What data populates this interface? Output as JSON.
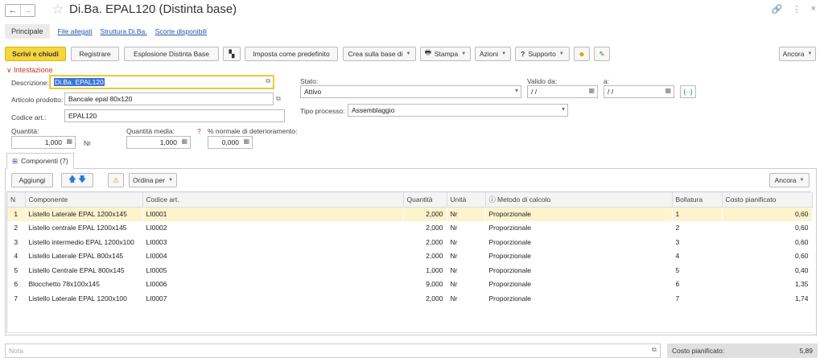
{
  "header": {
    "title": "Di.Ba. EPAL120 (Distinta base)",
    "back": "←",
    "forward": "→",
    "star": "☆",
    "link": "🔗",
    "more": "⋮",
    "close": "×"
  },
  "tabs": [
    {
      "label": "Principale"
    },
    {
      "label": "File allegati"
    },
    {
      "label": "Struttura Di.Ba."
    },
    {
      "label": "Scorte disponibili"
    }
  ],
  "toolbar": {
    "write_close": "Scrivi e chiudi",
    "register": "Registrare",
    "explode": "Esplosione Distinta Base",
    "set_default": "Imposta come predefinito",
    "create_based": "Crea sulla base di",
    "print": "Stampa",
    "actions": "Azioni",
    "support": "Supporto",
    "more": "Ancora"
  },
  "section": {
    "label": "Intestazione"
  },
  "form": {
    "descrizione_label": "Descrizione:",
    "descrizione_value": "Di.Ba. EPAL120",
    "articolo_label": "Articolo prodotto:",
    "articolo_value": "Bancale epal 80x120",
    "codice_label": "Codice art.:",
    "codice_value": "EPAL120",
    "quantita_label": "Quantità:",
    "quantita_value": "1,000",
    "unit": "Nr",
    "quantita_media_label": "Quantità media:",
    "quantita_media_value": "1,000",
    "req_mark": "?",
    "deter_label": "% normale di deterioramento:",
    "deter_value": "0,000",
    "stato_label": "Stato:",
    "stato_value": "Attivo",
    "valido_label": "Valido da:",
    "valido_value": " / /",
    "a_label": "a:",
    "a_value": " / /",
    "tipo_label": "Tipo processo:",
    "tipo_value": "Assemblaggio"
  },
  "components": {
    "tab_label": "Componenti (7)",
    "add": "Aggiungi",
    "sort": "Ordina per",
    "more": "Ancora",
    "columns": [
      "N",
      "Componente",
      "Codice art.",
      "Quantità",
      "Unità",
      "Metodo di calcolo",
      "Bollatura",
      "Costo pianificato"
    ],
    "rows": [
      {
        "n": "1",
        "name": "Listello Laterale EPAL 1200x145",
        "code": "LI0001",
        "qty": "2,000",
        "unit": "Nr",
        "method": "Proporzionale",
        "stamp": "1",
        "cost": "0,60"
      },
      {
        "n": "2",
        "name": "Listello centrale EPAL 1200x145",
        "code": "LI0002",
        "qty": "2,000",
        "unit": "Nr",
        "method": "Proporzionale",
        "stamp": "2",
        "cost": "0,60"
      },
      {
        "n": "3",
        "name": "Listello intermedio EPAL 1200x100",
        "code": "LI0003",
        "qty": "2,000",
        "unit": "Nr",
        "method": "Proporzionale",
        "stamp": "3",
        "cost": "0,60"
      },
      {
        "n": "4",
        "name": "Listello Laterale EPAL 800x145",
        "code": "LI0004",
        "qty": "2,000",
        "unit": "Nr",
        "method": "Proporzionale",
        "stamp": "4",
        "cost": "0,60"
      },
      {
        "n": "5",
        "name": "Listello Centrale EPAL 800x145",
        "code": "LI0005",
        "qty": "1,000",
        "unit": "Nr",
        "method": "Proporzionale",
        "stamp": "5",
        "cost": "0,40"
      },
      {
        "n": "6",
        "name": "Blocchetto 78x100x145",
        "code": "LI0006",
        "qty": "9,000",
        "unit": "Nr",
        "method": "Proporzionale",
        "stamp": "6",
        "cost": "1,35"
      },
      {
        "n": "7",
        "name": "Listello Laterale EPAL 1200x100",
        "code": "LI0007",
        "qty": "2,000",
        "unit": "Nr",
        "method": "Proporzionale",
        "stamp": "7",
        "cost": "1,74"
      }
    ]
  },
  "footer": {
    "note_placeholder": "Nota",
    "cost_label": "Costo pianificato:",
    "cost_value": "5,89"
  },
  "colors": {
    "primary_button": "#f7d53c",
    "highlight_row": "#fdf3cd",
    "link": "#2255aa",
    "section": "#c0392b"
  }
}
